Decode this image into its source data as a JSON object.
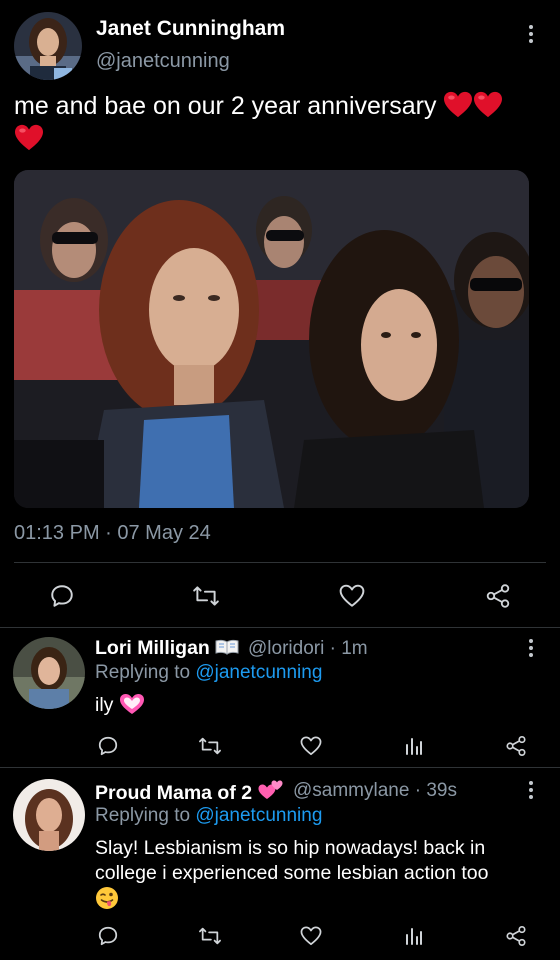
{
  "tweet": {
    "author_name": "Janet Cunningham",
    "author_handle": "@janetcunning",
    "text": "me and bae on our 2 year anniversary",
    "timestamp": "01:13 PM · 07 May 24"
  },
  "replies": [
    {
      "name": "Lori Milligan",
      "name_emoji": "open-book",
      "handle_time": "@loridori · 1m",
      "replying_prefix": "Replying to ",
      "replying_to": "@janetcunning",
      "text": "ily",
      "text_emoji": "sparkling-heart"
    },
    {
      "name": "Proud Mama of 2",
      "name_emoji": "two-hearts",
      "handle_time": "@sammylane · 39s",
      "replying_prefix": "Replying to ",
      "replying_to": "@janetcunning",
      "text": "Slay! Lesbianism is so hip nowadays! back in college i experienced some lesbian action too",
      "text_emoji": "winking-tongue-face"
    }
  ],
  "colors": {
    "background": "#000000",
    "secondary_text": "#8b98a5",
    "link": "#1d9bf0",
    "heart_red": "#e0102a",
    "divider": "#2f3336"
  }
}
